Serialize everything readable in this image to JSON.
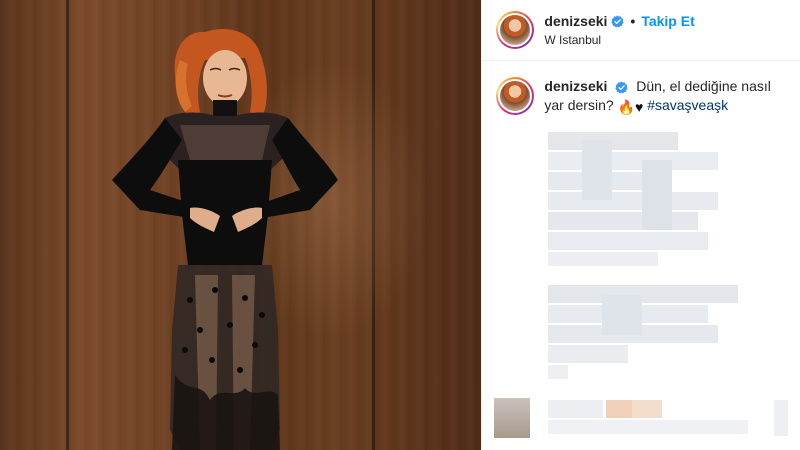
{
  "post": {
    "username": "denizseki",
    "follow_label": "Takip Et",
    "dot": "•",
    "location": "W Istanbul",
    "caption": {
      "text_before": "Dün, el dediğine nasıl yar dersin?",
      "emoji_fire": "🔥",
      "emoji_heart": "♥",
      "hashtag": "#savaşveaşk"
    }
  },
  "colors": {
    "verified_blue": "#3897f0",
    "follow_blue": "#0095f6",
    "hashtag": "#00376b",
    "border": "#efefef"
  },
  "icons": {
    "verified": "verified-badge-icon"
  }
}
